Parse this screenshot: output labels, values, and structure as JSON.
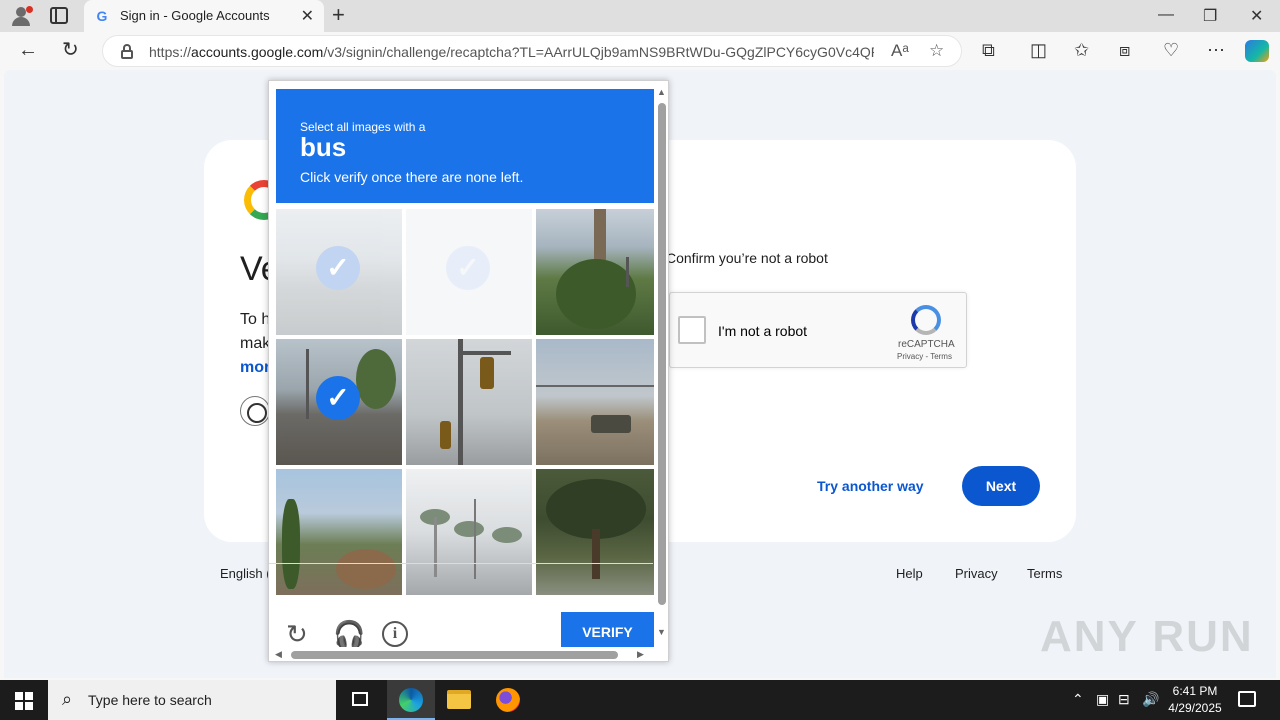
{
  "browser": {
    "tab_title": "Sign in - Google Accounts",
    "tab_favicon": "G",
    "new_tab": "+",
    "minimize": "—",
    "restore": "❐",
    "close": "✕",
    "url_prefix": "https://",
    "url_host": "accounts.google.com",
    "url_path": "/v3/signin/challenge/recaptcha?TL=AArrULQjb9amNS9BRtWDu-GQgZlPCY6cyG0Vc4QR..."
  },
  "page": {
    "heading_partial": "Ve",
    "line1_partial": "To h",
    "line2_partial": "mak",
    "link_partial": "mor",
    "confirm_text": "Confirm you’re not a robot",
    "recaptcha": {
      "checkbox_label": "I'm not a robot",
      "brand": "reCAPTCHA",
      "privacy_terms": "Privacy - Terms"
    },
    "try_another_way": "Try another way",
    "next": "Next",
    "footer": {
      "language_partial": "English (",
      "help": "Help",
      "privacy": "Privacy",
      "terms": "Terms"
    }
  },
  "challenge": {
    "instruction_small": "Select all images with a",
    "target": "bus",
    "instruction_detail": "Click verify once there are none left.",
    "tiles": [
      {
        "id": 1,
        "selected": true,
        "faded": true
      },
      {
        "id": 2,
        "selected": true,
        "faded": true
      },
      {
        "id": 3,
        "selected": false
      },
      {
        "id": 4,
        "selected": true
      },
      {
        "id": 5,
        "selected": false
      },
      {
        "id": 6,
        "selected": false
      },
      {
        "id": 7,
        "selected": false
      },
      {
        "id": 8,
        "selected": false
      },
      {
        "id": 9,
        "selected": false
      }
    ],
    "tick": "✓",
    "verify": "VERIFY"
  },
  "watermark": "ANY RUN",
  "taskbar": {
    "search_placeholder": "Type here to search",
    "time": "6:41 PM",
    "date": "4/29/2025"
  },
  "colors": {
    "accent_blue": "#1a73e8",
    "google_blue": "#0b57d0",
    "taskbar": "#1c1c1c"
  }
}
